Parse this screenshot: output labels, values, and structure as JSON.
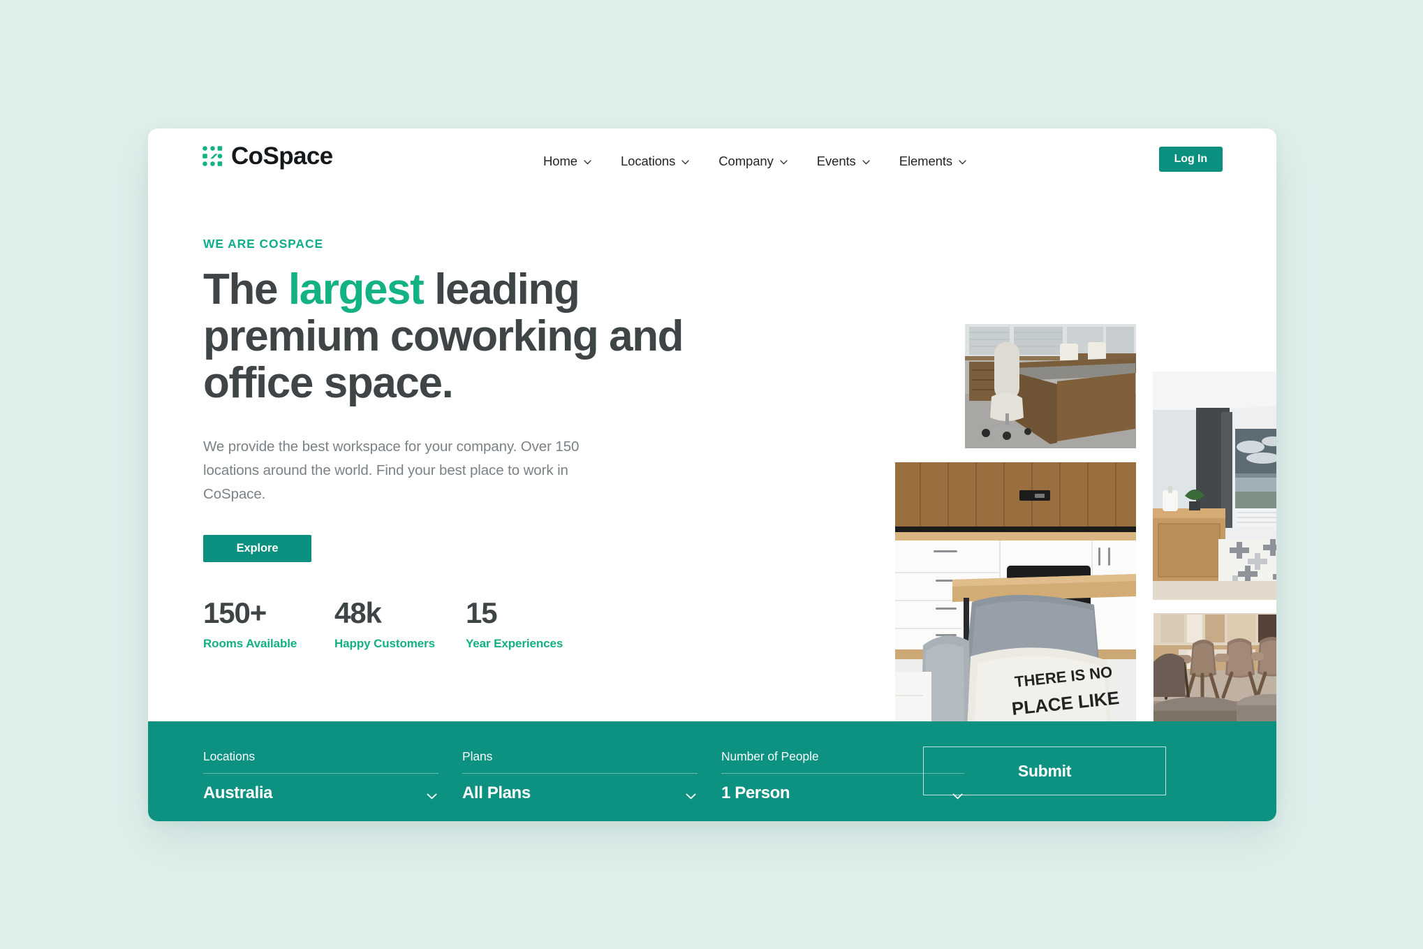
{
  "theme": {
    "page_background": "#dfefec",
    "card_background": "#ffffff",
    "brand_teal": "#0b8f7e",
    "bar_teal": "#0d9181",
    "accent_green": "#13b183",
    "heading_gray": "#3f4446",
    "body_gray": "#7b8287"
  },
  "header": {
    "logo": {
      "mark": "grid-dots-icon",
      "text": "CoSpace"
    },
    "nav": [
      {
        "label": "Home",
        "icon": "chevron-down-icon"
      },
      {
        "label": "Locations",
        "icon": "chevron-down-icon"
      },
      {
        "label": "Company",
        "icon": "chevron-down-icon"
      },
      {
        "label": "Events",
        "icon": "chevron-down-icon"
      },
      {
        "label": "Elements",
        "icon": "chevron-down-icon"
      }
    ],
    "login_label": "Log In"
  },
  "hero": {
    "eyebrow": "WE ARE COSPACE",
    "headline_part1": "The ",
    "headline_highlight": "largest",
    "headline_part2": " leading premium coworking and office space.",
    "paragraph": "We provide the best workspace for your company. Over 150 locations around the world. Find your best place to work in CoSpace.",
    "cta_label": "Explore",
    "stats": [
      {
        "value": "150+",
        "label": "Rooms Available"
      },
      {
        "value": "48k",
        "label": "Happy Customers"
      },
      {
        "value": "15",
        "label": "Year Experiences"
      }
    ]
  },
  "gallery": [
    {
      "name": "office-desk-photo",
      "alt": "Wooden executive desk with white office chair by windows"
    },
    {
      "name": "bright-room-photo",
      "alt": "Bright room with dark curtains, city view window and patterned rug"
    },
    {
      "name": "kitchen-lounge-photo",
      "alt": "Kitchen with wood cabinets and grey sofa with THERE IS NO PLACE LIKE HOME pillow"
    },
    {
      "name": "meeting-chairs-photo",
      "alt": "Brown upholstered chairs with wooden legs around a table"
    }
  ],
  "searchbar": {
    "fields": [
      {
        "label": "Locations",
        "value": "Australia",
        "icon": "chevron-down-icon"
      },
      {
        "label": "Plans",
        "value": "All Plans",
        "icon": "chevron-down-icon"
      },
      {
        "label": "Number of People",
        "value": "1 Person",
        "icon": "chevron-down-icon"
      }
    ],
    "submit_label": "Submit"
  }
}
